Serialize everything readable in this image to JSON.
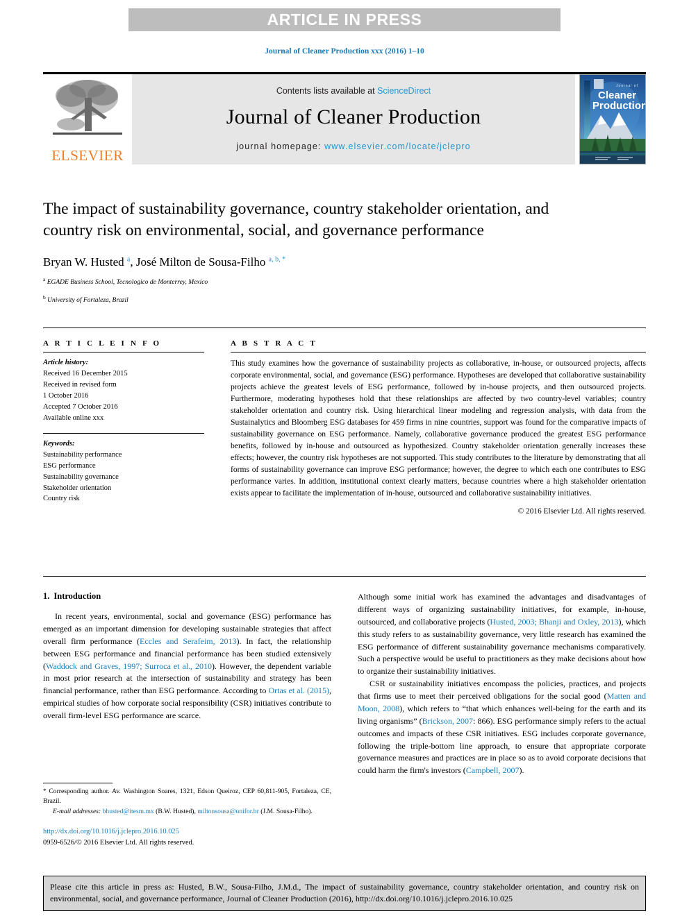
{
  "banner": {
    "label": "ARTICLE IN PRESS"
  },
  "running_head": {
    "text": "Journal of Cleaner Production xxx (2016) 1–10"
  },
  "masthead": {
    "publisher": "ELSEVIER",
    "contents_prefix": "Contents lists available at ",
    "contents_link": "ScienceDirect",
    "journal_name": "Journal of Cleaner Production",
    "homepage_prefix": "journal homepage: ",
    "homepage_url": "www.elsevier.com/locate/jclepro",
    "cover_title_small": "Journal of",
    "cover_title_line1": "Cleaner",
    "cover_title_line2": "Production"
  },
  "article": {
    "title": "The impact of sustainability governance, country stakeholder orientation, and country risk on environmental, social, and governance performance",
    "authors_part1": "Bryan W. Husted ",
    "authors_sup1": "a",
    "authors_part2": ", José Milton de Sousa-Filho ",
    "authors_sup2": "a, b, *",
    "affiliation_a_marker": "a",
    "affiliation_a": " EGADE Business School, Tecnologico de Monterrey, Mexico",
    "affiliation_b_marker": "b",
    "affiliation_b": " University of Fortaleza, Brazil"
  },
  "info": {
    "heading": "A R T I C L E  I N F O",
    "history_label": "Article history:",
    "history_lines": [
      "Received 16 December 2015",
      "Received in revised form",
      "1 October 2016",
      "Accepted 7 October 2016",
      "Available online xxx"
    ],
    "keywords_label": "Keywords:",
    "keywords": [
      "Sustainability performance",
      "ESG performance",
      "Sustainability governance",
      "Stakeholder orientation",
      "Country risk"
    ]
  },
  "abstract": {
    "heading": "A B S T R A C T",
    "text": "This study examines how the governance of sustainability projects as collaborative, in-house, or outsourced projects, affects corporate environmental, social, and governance (ESG) performance. Hypotheses are developed that collaborative sustainability projects achieve the greatest levels of ESG performance, followed by in-house projects, and then outsourced projects. Furthermore, moderating hypotheses hold that these relationships are affected by two country-level variables; country stakeholder orientation and country risk. Using hierarchical linear modeling and regression analysis, with data from the Sustainalytics and Bloomberg ESG databases for 459 firms in nine countries, support was found for the comparative impacts of sustainability governance on ESG performance. Namely, collaborative governance produced the greatest ESG performance benefits, followed by in-house and outsourced as hypothesized. Country stakeholder orientation generally increases these effects; however, the country risk hypotheses are not supported. This study contributes to the literature by demonstrating that all forms of sustainability governance can improve ESG performance; however, the degree to which each one contributes to ESG performance varies. In addition, institutional context clearly matters, because countries where a high stakeholder orientation exists appear to facilitate the implementation of in-house, outsourced and collaborative sustainability initiatives.",
    "copyright": "© 2016 Elsevier Ltd. All rights reserved."
  },
  "body": {
    "section_number": "1.",
    "section_title": "Introduction",
    "left_paragraph_1_a": "In recent years, environmental, social and governance (ESG) performance has emerged as an important dimension for developing sustainable strategies that affect overall firm performance (",
    "left_ref_1": "Eccles and Serafeim, 2013",
    "left_paragraph_1_b": "). In fact, the relationship between ESG performance and financial performance has been studied extensively (",
    "left_ref_2": "Waddock and Graves, 1997; Surroca et al., 2010",
    "left_paragraph_1_c": "). However, the dependent variable in most prior research at the intersection of sustainability and strategy has been financial performance, rather than ESG performance. According to ",
    "left_ref_3": "Ortas et al. (2015)",
    "left_paragraph_1_d": ", empirical studies of how corporate social responsibility (CSR) initiatives contribute to overall firm-level ESG performance are scarce.",
    "right_paragraph_1_a": "Although some initial work has examined the advantages and disadvantages of different ways of organizing sustainability initiatives, for example, in-house, outsourced, and collaborative projects (",
    "right_ref_1": "Husted, 2003; Bhanji and Oxley, 2013",
    "right_paragraph_1_b": "), which this study refers to as sustainability governance, very little research has examined the ESG performance of different sustainability governance mechanisms comparatively. Such a perspective would be useful to practitioners as they make decisions about how to organize their sustainability initiatives.",
    "right_paragraph_2_a": "CSR or sustainability initiatives encompass the policies, practices, and projects that firms use to meet their perceived obligations for the social good (",
    "right_ref_2": "Matten and Moon, 2008",
    "right_paragraph_2_b": "), which refers to “that which enhances well-being for the earth and its living organisms” (",
    "right_ref_3": "Brickson, 2007",
    "right_paragraph_2_c": ": 866). ESG performance simply refers to the actual outcomes and impacts of these CSR initiatives. ESG includes corporate governance, following the triple-bottom line approach, to ensure that appropriate corporate governance measures and practices are in place so as to avoid corporate decisions that could harm the firm's investors (",
    "right_ref_4": "Campbell, 2007",
    "right_paragraph_2_d": ")."
  },
  "footnotes": {
    "star_marker": "*",
    "corresponding": " Corresponding author. Av. Washington Soares, 1321, Edson Queiroz, CEP 60,811-905, Fortaleza, CE, Brazil.",
    "email_label": "E-mail addresses:",
    "email_1": "bhusted@itesm.mx",
    "email_1_owner": " (B.W. Husted), ",
    "email_2": "miltonsousa@unifor.br",
    "email_2_owner": " (J.M. Sousa-Filho).",
    "doi_url": "http://dx.doi.org/10.1016/j.jclepro.2016.10.025",
    "issn_line": "0959-6526/© 2016 Elsevier Ltd. All rights reserved."
  },
  "citation": {
    "text": "Please cite this article in press as: Husted, B.W., Sousa-Filho, J.M.d., The impact of sustainability governance, country stakeholder orientation, and country risk on environmental, social, and governance performance, Journal of Cleaner Production (2016), http://dx.doi.org/10.1016/j.jclepro.2016.10.025"
  },
  "colors": {
    "link_blue": "#1a7bb9",
    "sd_blue": "#2196cf",
    "elsevier_orange": "#ec7c26",
    "banner_gray": "#bdbdbd",
    "masthead_gray": "#e6e6e6",
    "cite_gray": "#d5d5d5"
  }
}
